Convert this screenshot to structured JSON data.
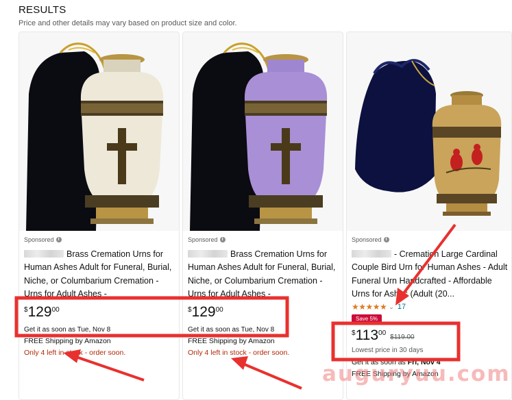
{
  "header": {
    "title": "RESULTS",
    "subtitle": "Price and other details may vary based on product size and color."
  },
  "products": [
    {
      "sponsored": "Sponsored",
      "title": "Brass Cremation Urns for Human Ashes Adult for Funeral, Burial, Niche, or Columbarium Cremation - Urns for Adult Ashes -",
      "price_symbol": "$",
      "price_whole": "129",
      "price_fraction": "00",
      "delivery": "Get it as soon as Tue, Nov 8",
      "shipping": "FREE Shipping by Amazon",
      "stock": "Only 4 left in stock - order soon.",
      "urn_color": "#ede8d8"
    },
    {
      "sponsored": "Sponsored",
      "title": "Brass Cremation Urns for Human Ashes Adult for Funeral, Burial, Niche, or Columbarium Cremation - Urns for Adult Ashes -",
      "price_symbol": "$",
      "price_whole": "129",
      "price_fraction": "00",
      "delivery": "Get it as soon as Tue, Nov 8",
      "shipping": "FREE Shipping by Amazon",
      "stock": "Only 4 left in stock - order soon.",
      "urn_color": "#a98fd6"
    },
    {
      "sponsored": "Sponsored",
      "title": "- Cremation Large Cardinal Couple Bird Urn for Human Ashes - Adult Funeral Urn Handcrafted - Affordable Urns for Ashes (Adult (20...",
      "stars": "★★★★★",
      "rating": 4.5,
      "rating_count": "17",
      "save_badge": "Save 5%",
      "price_symbol": "$",
      "price_whole": "113",
      "price_fraction": "00",
      "list_price": "$119.00",
      "lowest_price": "Lowest price in 30 days",
      "delivery_prefix": "Get it as soon as ",
      "delivery_date": "Fri, Nov 4",
      "shipping": "FREE Shipping by Amazon",
      "urn_color": "#c9a45a"
    }
  ],
  "watermark": "auguryuu.com",
  "colors": {
    "price_red": "#b12704",
    "link_teal": "#007185",
    "star_orange": "#de7921",
    "annotation_red": "#e8312f",
    "badge_red": "#cc0c39"
  }
}
